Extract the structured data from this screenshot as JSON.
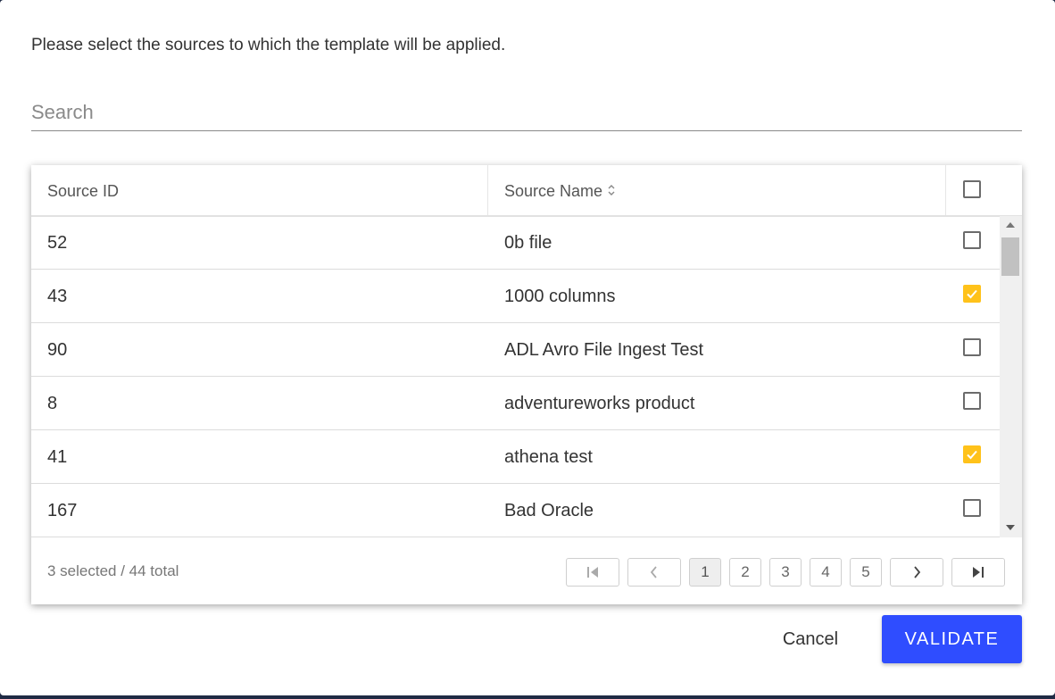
{
  "dialog": {
    "instruction": "Please select the sources to which the template will be applied.",
    "search_placeholder": "Search"
  },
  "table": {
    "columns": {
      "source_id": "Source ID",
      "source_name": "Source Name"
    },
    "rows": [
      {
        "id": "52",
        "name": "0b file",
        "checked": false
      },
      {
        "id": "43",
        "name": "1000 columns",
        "checked": true
      },
      {
        "id": "90",
        "name": "ADL Avro File Ingest Test",
        "checked": false
      },
      {
        "id": "8",
        "name": "adventureworks product",
        "checked": false
      },
      {
        "id": "41",
        "name": "athena test",
        "checked": true
      },
      {
        "id": "167",
        "name": "Bad Oracle",
        "checked": false
      }
    ],
    "footer": {
      "summary": "3 selected / 44 total"
    },
    "pagination": {
      "pages": [
        "1",
        "2",
        "3",
        "4",
        "5"
      ],
      "current": "1"
    }
  },
  "actions": {
    "cancel_label": "Cancel",
    "validate_label": "VALIDATE"
  },
  "colors": {
    "accent": "#2f4dff",
    "checkbox_checked": "#ffc21a"
  },
  "icons": {
    "sort": "sort-updown-icon",
    "first": "first-page-icon",
    "prev": "chevron-left-icon",
    "next": "chevron-right-icon",
    "last": "last-page-icon",
    "check": "checkmark-icon"
  }
}
